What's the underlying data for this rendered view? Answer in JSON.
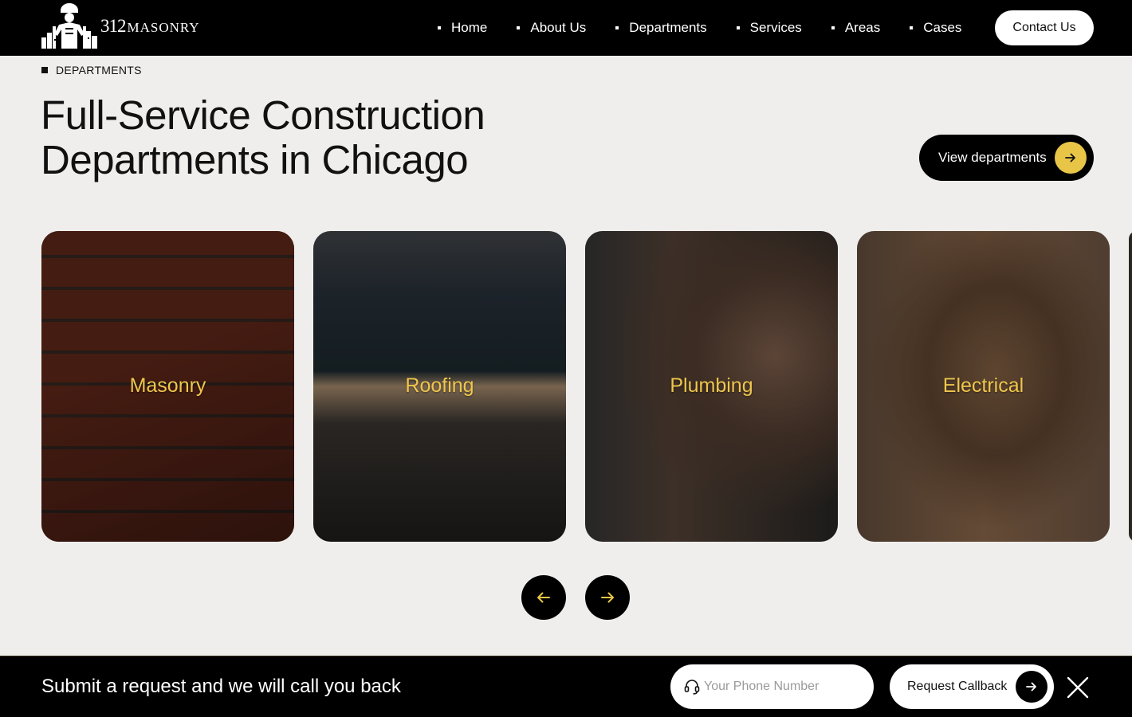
{
  "header": {
    "logo_number": "312",
    "logo_word": "MASONRY",
    "nav": [
      "Home",
      "About Us",
      "Departments",
      "Services",
      "Areas",
      "Cases"
    ],
    "contact_label": "Contact Us"
  },
  "section": {
    "eyebrow": "DEPARTMENTS",
    "headline_line1": "Full-Service Construction",
    "headline_line2": "Departments in Chicago",
    "view_button": "View departments"
  },
  "cards": [
    {
      "label": "Masonry"
    },
    {
      "label": "Roofing"
    },
    {
      "label": "Plumbing"
    },
    {
      "label": "Electrical"
    }
  ],
  "callbar": {
    "text": "Submit a request and we will call you back",
    "phone_placeholder": "Your Phone Number",
    "button_label": "Request Callback"
  },
  "colors": {
    "accent": "#e8c547",
    "card_label": "#efc64d",
    "background": "#efeeec",
    "dark": "#000000"
  },
  "icons": {
    "logo": "worker-skyline-logo",
    "arrow_right": "arrow-right-icon",
    "arrow_left": "arrow-left-icon",
    "headset": "headset-icon",
    "close": "close-icon"
  }
}
